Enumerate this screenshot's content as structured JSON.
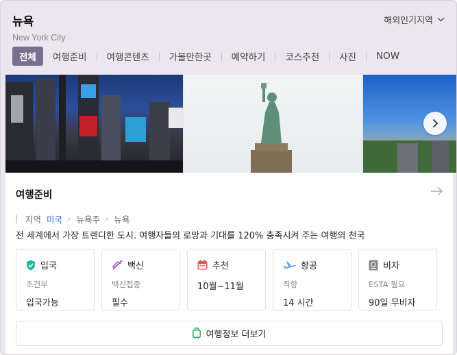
{
  "header": {
    "title": "뉴욕",
    "subtitle": "New York City",
    "region_label": "해외인기지역"
  },
  "tabs": [
    {
      "label": "전체",
      "active": true
    },
    {
      "label": "여행준비"
    },
    {
      "label": "여행콘텐츠"
    },
    {
      "label": "가볼만한곳"
    },
    {
      "label": "예약하기"
    },
    {
      "label": "코스추천"
    },
    {
      "label": "사진"
    },
    {
      "label": "NOW"
    }
  ],
  "gallery": {
    "photos": [
      "times-square",
      "statue-of-liberty",
      "central-park"
    ]
  },
  "panel": {
    "title": "여행준비",
    "breadcrumb": [
      "지역",
      "미국",
      "뉴욕주",
      "뉴욕"
    ],
    "description": "전 세계에서 가장 트렌디한 도시. 여행자들의 로망과 기대를 120% 충족시켜 주는 여행의 천국",
    "cards": [
      {
        "icon": "shield-check-icon",
        "title": "입국",
        "sub": "조건부",
        "value": "입국가능"
      },
      {
        "icon": "syringe-icon",
        "title": "백신",
        "sub": "백신접종",
        "value": "필수"
      },
      {
        "icon": "calendar-icon",
        "title": "추천",
        "sub": "",
        "value": "10월~11월"
      },
      {
        "icon": "airplane-icon",
        "title": "항공",
        "sub": "직항",
        "value": "14 시간"
      },
      {
        "icon": "passport-icon",
        "title": "비자",
        "sub": "ESTA 필요",
        "value": "90일 무비자"
      }
    ],
    "more_label": "여행정보 더보기"
  },
  "colors": {
    "active_tab": "#7a6f8e",
    "link": "#2a6fc9",
    "shield": "#20b7a6",
    "syringe": "#9a5fc4",
    "calendar": "#e35b5b",
    "airplane": "#6aa2e0",
    "passport": "#888888",
    "more_icon": "#1aa34a"
  }
}
